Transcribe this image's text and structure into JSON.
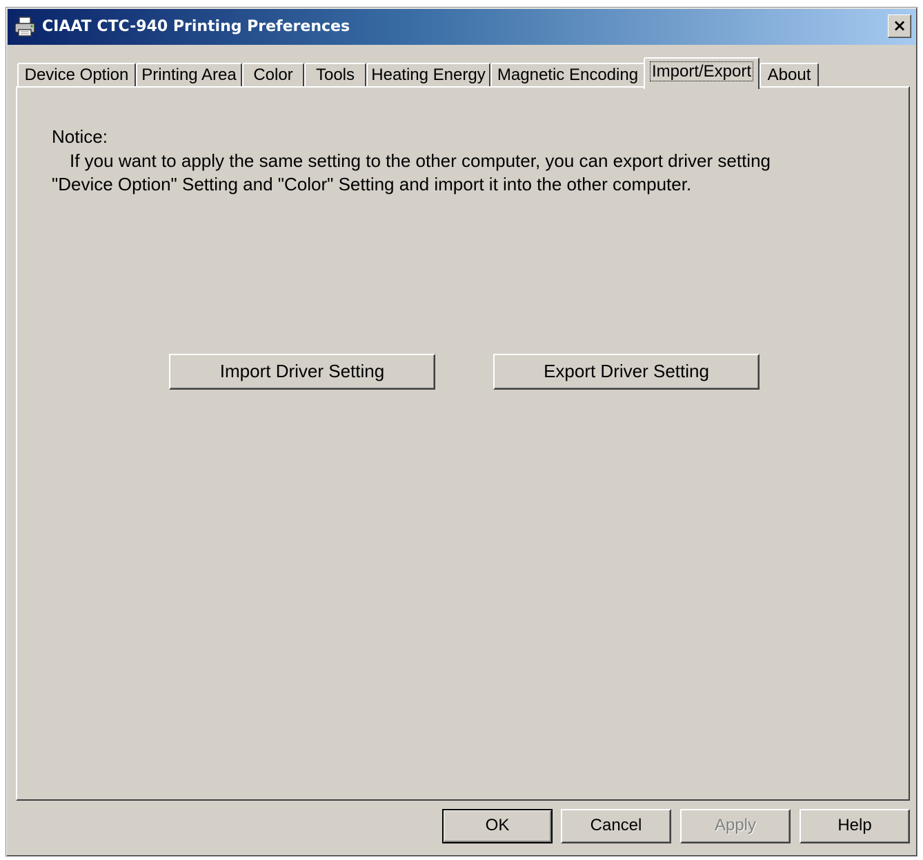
{
  "window": {
    "title": "CIAAT CTC-940 Printing Preferences",
    "close_label": "×"
  },
  "tabs": [
    {
      "label": "Device Option",
      "active": false
    },
    {
      "label": "Printing Area",
      "active": false
    },
    {
      "label": "Color",
      "active": false
    },
    {
      "label": "Tools",
      "active": false
    },
    {
      "label": "Heating Energy",
      "active": false
    },
    {
      "label": "Magnetic Encoding",
      "active": false
    },
    {
      "label": "Import/Export",
      "active": true
    },
    {
      "label": "About",
      "active": false
    }
  ],
  "panel": {
    "notice_title": "Notice:",
    "notice_line1": "If you want to apply the same setting to the other computer, you can export driver setting",
    "notice_line2": "\"Device Option\" Setting and \"Color\" Setting and import it into the other computer.",
    "import_button": "Import Driver Setting",
    "export_button": "Export Driver Setting"
  },
  "footer": {
    "ok": "OK",
    "cancel": "Cancel",
    "apply": "Apply",
    "apply_enabled": false,
    "help": "Help"
  },
  "colors": {
    "titlebar_start": "#0a246a",
    "titlebar_end": "#a6caf0",
    "face": "#d4d0c8"
  }
}
